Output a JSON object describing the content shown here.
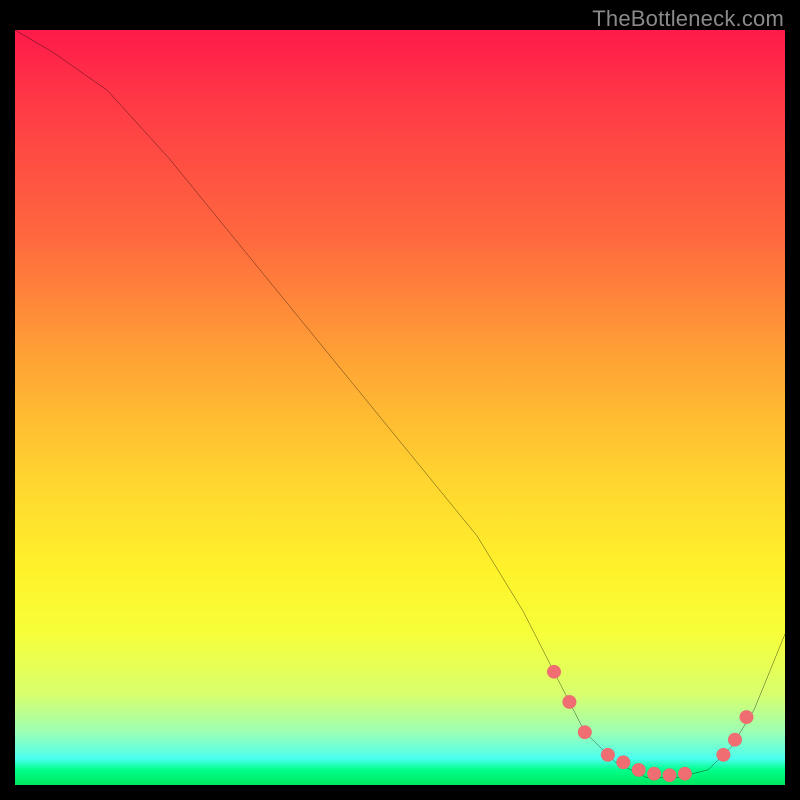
{
  "attribution": "TheBottleneck.com",
  "colors": {
    "line": "#000000",
    "marker_fill": "#f06d72",
    "marker_stroke": "#d24a50"
  },
  "chart_data": {
    "type": "line",
    "title": "",
    "xlabel": "",
    "ylabel": "",
    "xlim": [
      0,
      100
    ],
    "ylim": [
      0,
      100
    ],
    "series": [
      {
        "name": "curve",
        "x": [
          0,
          5,
          12,
          20,
          28,
          36,
          44,
          52,
          60,
          66,
          70,
          74,
          78,
          82,
          86,
          90,
          93,
          96,
          100
        ],
        "y": [
          100,
          97,
          92,
          83,
          73,
          63,
          53,
          43,
          33,
          23,
          15,
          7,
          3,
          1,
          1,
          2,
          5,
          10,
          20
        ]
      }
    ],
    "markers": {
      "name": "highlight",
      "x": [
        70,
        72,
        74,
        77,
        79,
        81,
        83,
        85,
        87,
        92,
        93.5,
        95
      ],
      "y": [
        15,
        11,
        7,
        4,
        3,
        2,
        1.5,
        1.3,
        1.5,
        4,
        6,
        9
      ]
    }
  }
}
